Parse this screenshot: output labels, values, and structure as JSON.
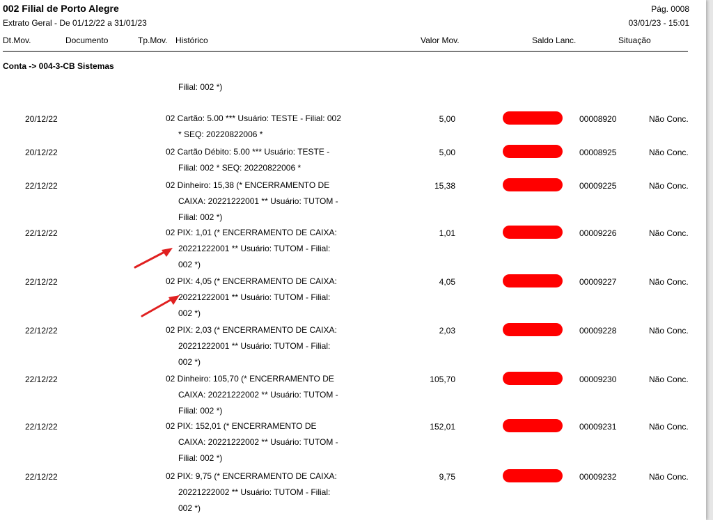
{
  "header": {
    "title": "002 Filial de Porto Alegre",
    "subtitle": "Extrato Geral - De 01/12/22 a 31/01/23",
    "page_number": "Pág. 0008",
    "printed_at": "03/01/23 - 15:01"
  },
  "columns": {
    "date": "Dt.Mov.",
    "document": "Documento",
    "type": "Tp.Mov.",
    "history": "Histórico",
    "value": "Valor Mov.",
    "balance": "Saldo Lanc.",
    "status": "Situação"
  },
  "account": "Conta -> 004-3-CB Sistemas",
  "continuation": "Filial: 002 *)",
  "redaction_color": "#ff0000",
  "arrow_color": "#e02020",
  "rows": [
    {
      "date": "20/12/22",
      "history": [
        "02 Cartão: 5.00 *** Usuário: TESTE - Filial: 002",
        "* SEQ: 20220822006 *"
      ],
      "value": "5,00",
      "balance": "00008920",
      "status": "Não Conc."
    },
    {
      "date": "20/12/22",
      "history": [
        "02 Cartão Débito: 5.00 *** Usuário: TESTE -",
        "Filial: 002 * SEQ: 20220822006 *"
      ],
      "value": "5,00",
      "balance": "00008925",
      "status": "Não Conc."
    },
    {
      "date": "22/12/22",
      "history": [
        "02 Dinheiro: 15,38 (* ENCERRAMENTO DE",
        "CAIXA: 20221222001 ** Usuário: TUTOM -",
        "Filial: 002 *)"
      ],
      "value": "15,38",
      "balance": "00009225",
      "status": "Não Conc."
    },
    {
      "date": "22/12/22",
      "history": [
        "02 PIX: 1,01 (* ENCERRAMENTO DE CAIXA:",
        "20221222001 ** Usuário: TUTOM - Filial:",
        "002 *)"
      ],
      "value": "1,01",
      "balance": "00009226",
      "status": "Não Conc."
    },
    {
      "date": "22/12/22",
      "history": [
        "02 PIX: 4,05 (* ENCERRAMENTO DE CAIXA:",
        "20221222001 ** Usuário: TUTOM - Filial:",
        "002 *)"
      ],
      "value": "4,05",
      "balance": "00009227",
      "status": "Não Conc."
    },
    {
      "date": "22/12/22",
      "history": [
        "02 PIX: 2,03 (* ENCERRAMENTO DE CAIXA:",
        "20221222001 ** Usuário: TUTOM - Filial:",
        "002 *)"
      ],
      "value": "2,03",
      "balance": "00009228",
      "status": "Não Conc."
    },
    {
      "date": "22/12/22",
      "history": [
        "02 Dinheiro: 105,70 (* ENCERRAMENTO DE",
        "CAIXA: 20221222002 ** Usuário: TUTOM -",
        "Filial: 002 *)"
      ],
      "value": "105,70",
      "balance": "00009230",
      "status": "Não Conc."
    },
    {
      "date": "22/12/22",
      "history": [
        "02 PIX: 152,01 (* ENCERRAMENTO DE",
        "CAIXA: 20221222002 ** Usuário: TUTOM -",
        "Filial: 002 *)"
      ],
      "value": "152,01",
      "balance": "00009231",
      "status": "Não Conc."
    },
    {
      "date": "22/12/22",
      "history": [
        "02 PIX: 9,75 (* ENCERRAMENTO DE CAIXA:",
        "20221222002 ** Usuário: TUTOM - Filial:",
        "002 *)"
      ],
      "value": "9,75",
      "balance": "00009232",
      "status": "Não Conc."
    }
  ]
}
